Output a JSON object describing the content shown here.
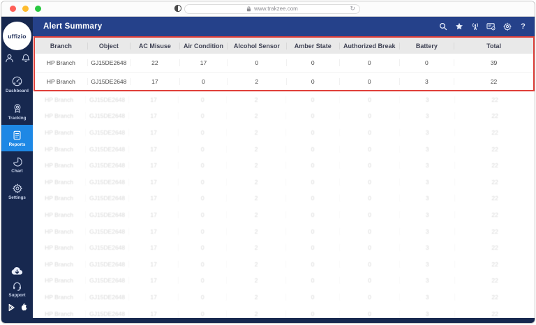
{
  "colors": {
    "sidebar_bg": "#17284f",
    "header_bg": "#25418a",
    "active_item_bg": "#1e88e5",
    "highlight_border": "#e0403a",
    "table_header_bg": "#e9e9e9",
    "traffic_lights": [
      "#ff5f57",
      "#febc2e",
      "#28c840"
    ]
  },
  "browser": {
    "url": "www.trakzee.com",
    "refresh_glyph": "↻"
  },
  "logo": {
    "text": "uffizio"
  },
  "header": {
    "title": "Alert Summary",
    "icons": [
      {
        "name": "search-icon"
      },
      {
        "name": "star-icon"
      },
      {
        "name": "antenna-icon"
      },
      {
        "name": "screen-gear-icon"
      },
      {
        "name": "gear-icon"
      },
      {
        "name": "help-icon"
      }
    ]
  },
  "sidebar": {
    "top_icons": [
      {
        "name": "user-icon"
      },
      {
        "name": "bell-icon"
      }
    ],
    "items": [
      {
        "label": "Dashboard",
        "icon": "dashboard-icon",
        "active": false
      },
      {
        "label": "Tracking",
        "icon": "tracking-icon",
        "active": false
      },
      {
        "label": "Reports",
        "icon": "reports-icon",
        "active": true
      },
      {
        "label": "Chart",
        "icon": "chart-icon",
        "active": false
      },
      {
        "label": "Settings",
        "icon": "settings-icon",
        "active": false
      }
    ],
    "bottom": {
      "download_icon": "cloud-download-icon",
      "support_label": "Support",
      "support_icon": "headset-icon",
      "store_icons": [
        "play-store-icon",
        "apple-icon"
      ]
    }
  },
  "table": {
    "columns": [
      "Branch",
      "Object",
      "AC Misuse",
      "Air Condition",
      "Alcohol Sensor",
      "Amber State",
      "Authorized Break",
      "Battery",
      "Total"
    ],
    "highlighted_rows": [
      [
        "HP Branch",
        "GJ15DE2648",
        "22",
        "17",
        "0",
        "0",
        "0",
        "0",
        "39"
      ],
      [
        "HP Branch",
        "GJ15DE2648",
        "17",
        "0",
        "2",
        "0",
        "0",
        "3",
        "22"
      ]
    ],
    "ghost_row": [
      "HP Branch",
      "GJ15DE2648",
      "17",
      "0",
      "2",
      "0",
      "0",
      "3",
      "22"
    ],
    "ghost_row_count": 14
  }
}
